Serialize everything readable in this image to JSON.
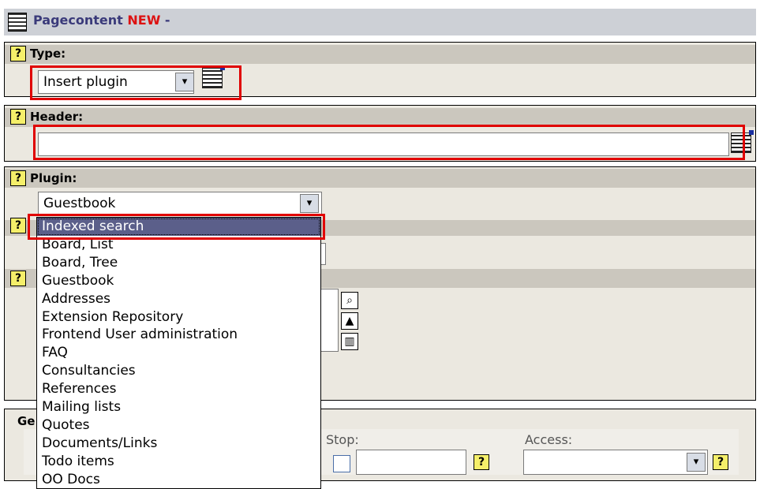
{
  "page": {
    "title_prefix": "Pagecontent",
    "title_new": "NEW",
    "title_suffix": " -"
  },
  "type_section": {
    "label": "Type:",
    "selected": "Insert plugin"
  },
  "header_section": {
    "label": "Header:",
    "value": ""
  },
  "plugin_section": {
    "label": "Plugin:",
    "selected": "Guestbook",
    "dropdown_items": [
      "Indexed search",
      "Board, List",
      "Board, Tree",
      "Guestbook",
      "Addresses",
      "Extension Repository",
      "Frontend User administration",
      "FAQ",
      "Consultancies",
      "References",
      "Mailing lists",
      "Quotes",
      "Documents/Links",
      "Todo items",
      "OO Docs"
    ],
    "highlighted_item": "Indexed search"
  },
  "general_section": {
    "label_fragment": "Ge",
    "stop_label": "Stop:",
    "access_label": "Access:",
    "stop_value": "",
    "access_value": ""
  },
  "icons": {
    "help": "?",
    "dropdown_arrow": "▾",
    "file_browse": "folder-icon",
    "move_up": "▲",
    "delete": "trash-icon"
  },
  "colors": {
    "highlight": "#e00000",
    "selected_bg": "#5b5f8a",
    "help_bg": "#f5ef6a"
  }
}
